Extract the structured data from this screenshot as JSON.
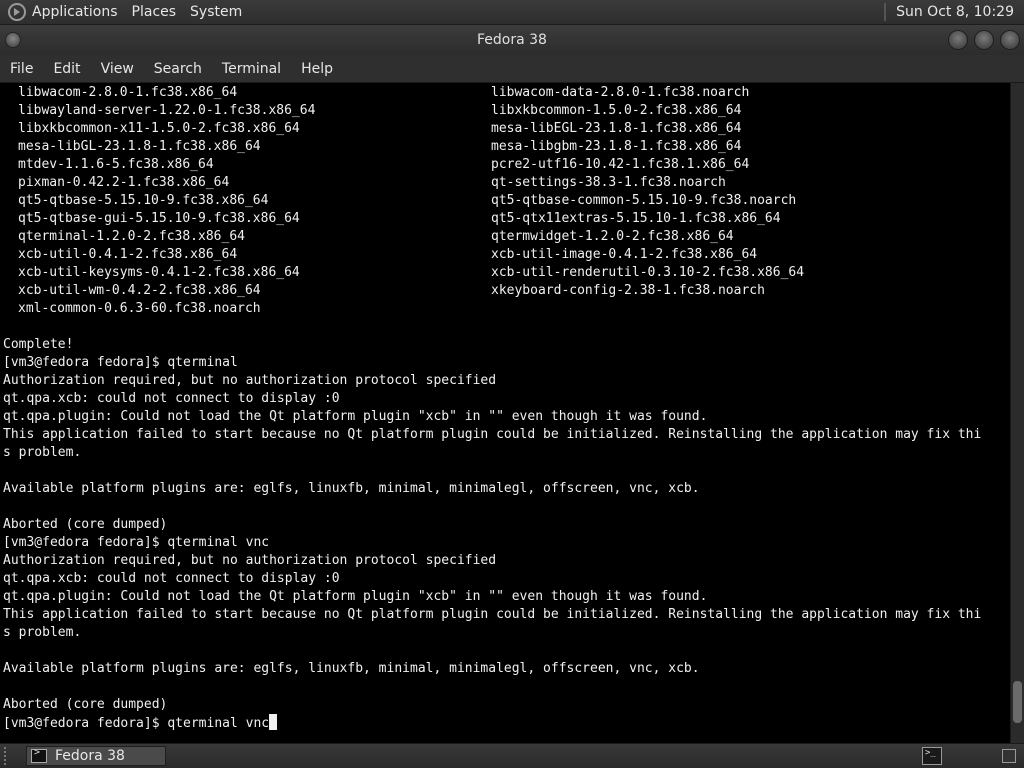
{
  "top_panel": {
    "menus": [
      "Applications",
      "Places",
      "System"
    ],
    "clock": "Sun Oct  8, 10:29"
  },
  "window": {
    "title": "Fedora 38",
    "menubar": [
      "File",
      "Edit",
      "View",
      "Search",
      "Terminal",
      "Help"
    ]
  },
  "terminal": {
    "packages": [
      [
        "libwacom-2.8.0-1.fc38.x86_64",
        "libwacom-data-2.8.0-1.fc38.noarch"
      ],
      [
        "libwayland-server-1.22.0-1.fc38.x86_64",
        "libxkbcommon-1.5.0-2.fc38.x86_64"
      ],
      [
        "libxkbcommon-x11-1.5.0-2.fc38.x86_64",
        "mesa-libEGL-23.1.8-1.fc38.x86_64"
      ],
      [
        "mesa-libGL-23.1.8-1.fc38.x86_64",
        "mesa-libgbm-23.1.8-1.fc38.x86_64"
      ],
      [
        "mtdev-1.1.6-5.fc38.x86_64",
        "pcre2-utf16-10.42-1.fc38.1.x86_64"
      ],
      [
        "pixman-0.42.2-1.fc38.x86_64",
        "qt-settings-38.3-1.fc38.noarch"
      ],
      [
        "qt5-qtbase-5.15.10-9.fc38.x86_64",
        "qt5-qtbase-common-5.15.10-9.fc38.noarch"
      ],
      [
        "qt5-qtbase-gui-5.15.10-9.fc38.x86_64",
        "qt5-qtx11extras-5.15.10-1.fc38.x86_64"
      ],
      [
        "qterminal-1.2.0-2.fc38.x86_64",
        "qtermwidget-1.2.0-2.fc38.x86_64"
      ],
      [
        "xcb-util-0.4.1-2.fc38.x86_64",
        "xcb-util-image-0.4.1-2.fc38.x86_64"
      ],
      [
        "xcb-util-keysyms-0.4.1-2.fc38.x86_64",
        "xcb-util-renderutil-0.3.10-2.fc38.x86_64"
      ],
      [
        "xcb-util-wm-0.4.2-2.fc38.x86_64",
        "xkeyboard-config-2.38-1.fc38.noarch"
      ],
      [
        "xml-common-0.6.3-60.fc38.noarch",
        ""
      ]
    ],
    "output": [
      "",
      "Complete!",
      "[vm3@fedora fedora]$ qterminal",
      "Authorization required, but no authorization protocol specified",
      "qt.qpa.xcb: could not connect to display :0",
      "qt.qpa.plugin: Could not load the Qt platform plugin \"xcb\" in \"\" even though it was found.",
      "This application failed to start because no Qt platform plugin could be initialized. Reinstalling the application may fix thi",
      "s problem.",
      "",
      "Available platform plugins are: eglfs, linuxfb, minimal, minimalegl, offscreen, vnc, xcb.",
      "",
      "Aborted (core dumped)",
      "[vm3@fedora fedora]$ qterminal vnc",
      "Authorization required, but no authorization protocol specified",
      "qt.qpa.xcb: could not connect to display :0",
      "qt.qpa.plugin: Could not load the Qt platform plugin \"xcb\" in \"\" even though it was found.",
      "This application failed to start because no Qt platform plugin could be initialized. Reinstalling the application may fix thi",
      "s problem.",
      "",
      "Available platform plugins are: eglfs, linuxfb, minimal, minimalegl, offscreen, vnc, xcb.",
      "",
      "Aborted (core dumped)"
    ],
    "prompt_line": "[vm3@fedora fedora]$ qterminal vnc"
  },
  "taskbar": {
    "window_button": "Fedora 38"
  },
  "icons": {
    "apps": "fedora-logo-icon",
    "task": "terminal-icon",
    "tray": "terminal-icon"
  }
}
